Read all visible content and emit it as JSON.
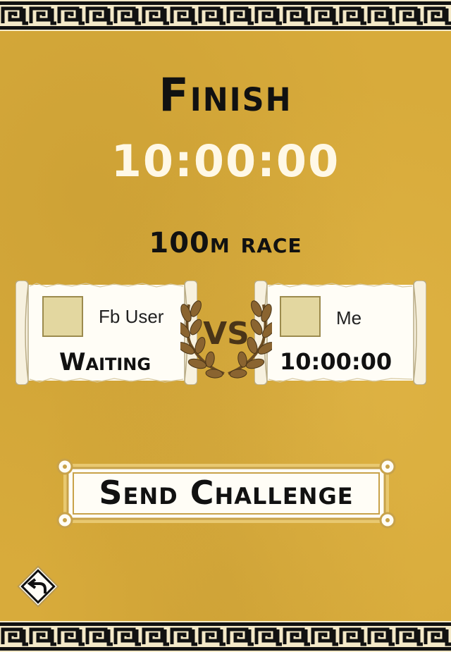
{
  "result": {
    "title": "Finish",
    "time": "10:00:00",
    "race_name": "100m race"
  },
  "opponent": {
    "name": "Fb User",
    "status": "Waiting"
  },
  "player": {
    "name": "Me",
    "time": "10:00:00"
  },
  "versus_label": "VS",
  "actions": {
    "send_challenge": "Send Challenge"
  },
  "icons": {
    "back": "back-arrow-icon",
    "laurel": "laurel-wreath-icon"
  },
  "colors": {
    "background": "#d8ab3b",
    "ink": "#111111",
    "time_text": "#fff8e6",
    "scroll": "#fffdf6",
    "laurel": "#8a6430"
  }
}
